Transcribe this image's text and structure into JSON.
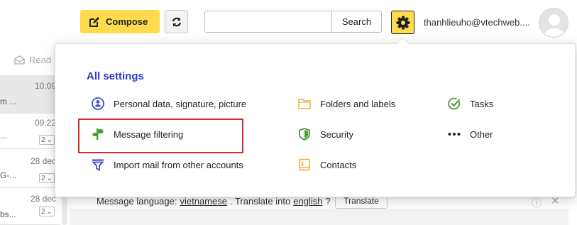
{
  "header": {
    "compose_label": "Compose",
    "search_placeholder": "",
    "search_value": "",
    "search_button": "Search",
    "user_email": "thanhlieuho@vtechweb....",
    "icons": [
      "pencil-icon",
      "refresh-icon",
      "gear-icon",
      "avatar"
    ]
  },
  "mail_toolbar": {
    "read_label": "Read"
  },
  "mail_list": [
    {
      "time": "10:09",
      "snippet": "m     ..."
    },
    {
      "time": "09:22",
      "snippet": "...",
      "count": "2"
    },
    {
      "time": "28 dec",
      "snippet": "G-...",
      "count": "2"
    },
    {
      "time": "28 dec",
      "snippet": "bs...",
      "count": "2"
    }
  ],
  "settings_menu": {
    "title": "All settings",
    "items": [
      {
        "label": "Personal data, signature, picture",
        "icon": "person-icon"
      },
      {
        "label": "Message filtering",
        "icon": "filter-sign-icon"
      },
      {
        "label": "Import mail from other accounts",
        "icon": "import-funnel-icon"
      },
      {
        "label": "Folders and labels",
        "icon": "folder-icon"
      },
      {
        "label": "Security",
        "icon": "shield-icon"
      },
      {
        "label": "Contacts",
        "icon": "contacts-icon"
      },
      {
        "label": "Tasks",
        "icon": "checkmark-icon"
      },
      {
        "label": "Other",
        "icon": "more-dots-icon"
      }
    ],
    "highlighted_item": "Message filtering"
  },
  "translate_bar": {
    "prefix": "Message language:",
    "language": "vietnamese",
    "middle": ". Translate into",
    "target": "english",
    "suffix": "?",
    "button": "Translate"
  },
  "colors": {
    "accent_yellow": "#ffdb4d",
    "title_blue": "#2d38c6",
    "highlight_red": "#d42a2e",
    "icon_blue": "#3b4bc8",
    "icon_orange": "#f0b445",
    "icon_green": "#4b9d3a"
  }
}
